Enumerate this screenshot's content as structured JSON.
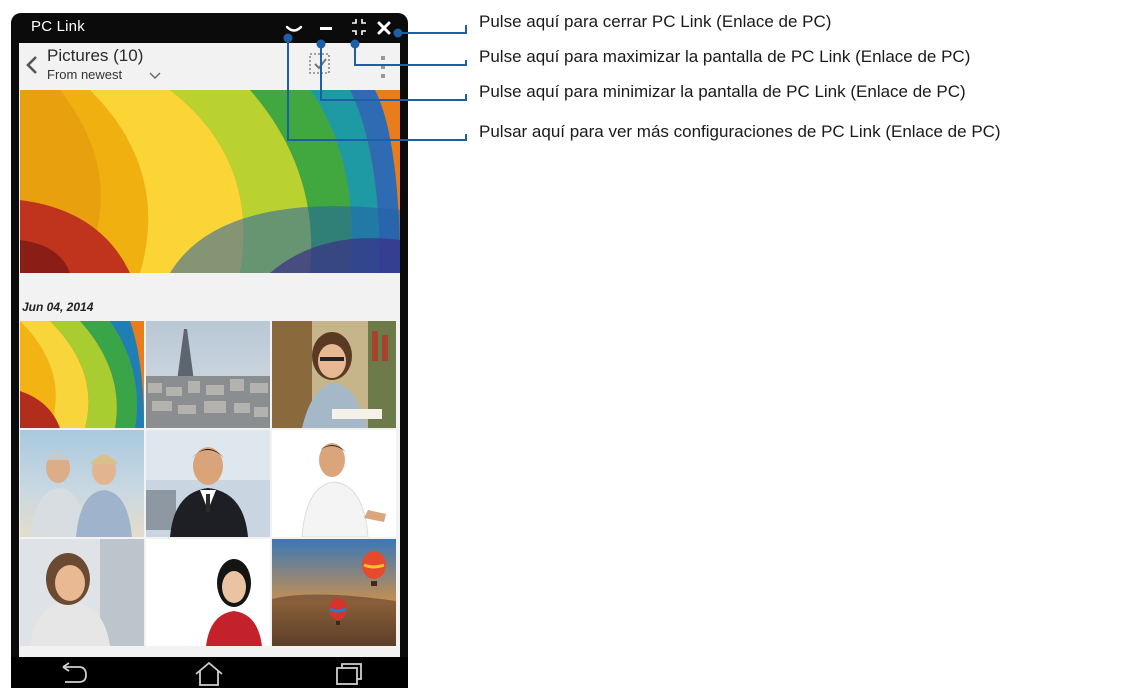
{
  "window": {
    "title": "PC Link",
    "titlebar_icons": [
      "chevron-down-icon",
      "minimize-icon",
      "maximize-icon",
      "close-icon"
    ]
  },
  "actionbar": {
    "title": "Pictures (10)",
    "sort_label": "From newest"
  },
  "gallery": {
    "date_label": "Jun 04,  2014",
    "thumbnails": [
      "rainbow-paper-image",
      "paris-eiffel-image",
      "woman-glasses-book-image",
      "couple-beach-image",
      "businessman-image",
      "man-white-tshirt-image",
      "woman-smiling-image",
      "woman-red-dress-image",
      "hot-air-balloons-image"
    ]
  },
  "navbar": {
    "icons": [
      "back-icon",
      "home-icon",
      "recent-apps-icon"
    ]
  },
  "callouts": [
    "Pulse aquí para cerrar PC Link (Enlace de PC)",
    "Pulse aquí para maximizar la pantalla de PC Link (Enlace de PC)",
    "Pulse aquí para minimizar la pantalla de PC Link (Enlace de PC)",
    "Pulsar aquí para ver más configuraciones de PC Link (Enlace de PC)"
  ],
  "colors": {
    "callout_line": "#1d5fa6",
    "window_frame": "#0b0b0b",
    "app_bg": "#f2f2f2"
  }
}
